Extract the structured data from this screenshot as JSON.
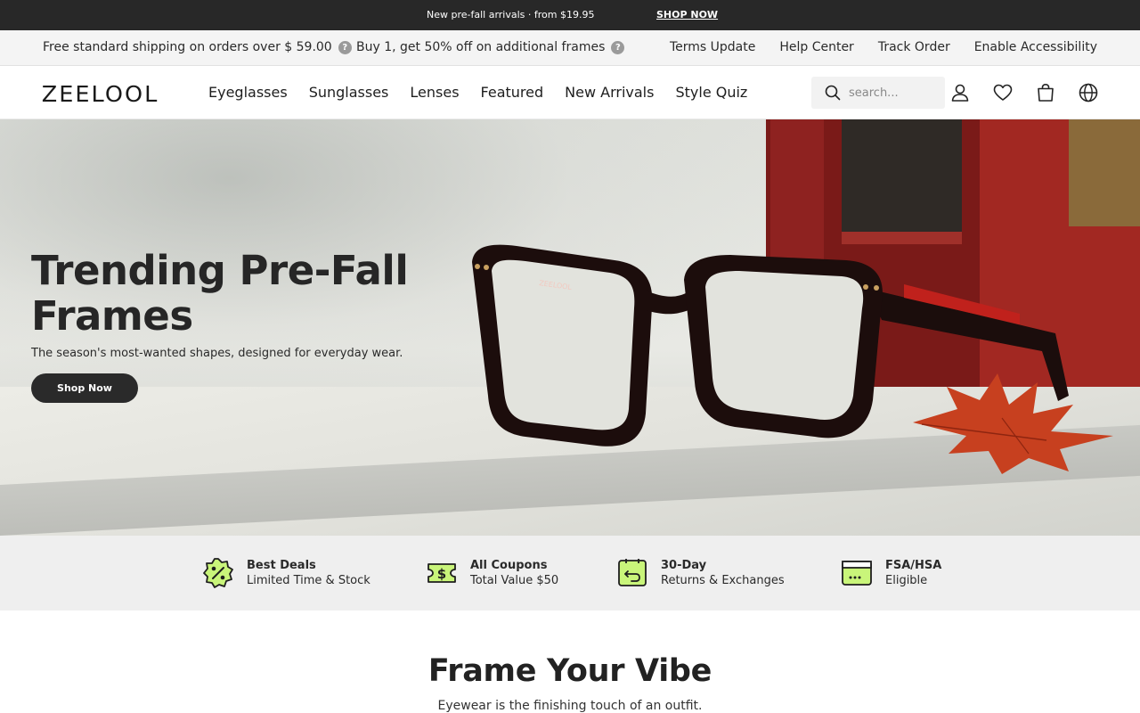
{
  "announcement": {
    "message": "New pre-fall arrivals · from $19.95",
    "cta": "SHOP NOW"
  },
  "utility": {
    "promos": [
      "Free standard shipping on orders over $ 59.00",
      "Buy 1, get 50% off on additional frames"
    ],
    "help_glyph": "?",
    "links": [
      "Terms Update",
      "Help Center",
      "Track Order",
      "Enable Accessibility"
    ]
  },
  "header": {
    "logo": "ZEELOOL",
    "nav": [
      "Eyeglasses",
      "Sunglasses",
      "Lenses",
      "Featured",
      "New Arrivals",
      "Style Quiz"
    ],
    "search_placeholder": "search...",
    "icons": [
      "search-icon",
      "account-icon",
      "wishlist-heart-icon",
      "shopping-bag-icon",
      "globe-icon"
    ]
  },
  "hero": {
    "title": "Trending Pre-Fall Frames",
    "subtitle": "The season's most-wanted shapes, designed for everyday wear.",
    "button": "Shop Now",
    "frame_brand": "ZEELOOL"
  },
  "benefits": [
    {
      "icon": "discount-badge-icon",
      "title": "Best Deals",
      "subtitle": "Limited Time & Stock"
    },
    {
      "icon": "coupon-ticket-icon",
      "title": "All Coupons",
      "subtitle": "Total Value $50"
    },
    {
      "icon": "return-arrow-icon",
      "title": "30-Day",
      "subtitle": "Returns & Exchanges"
    },
    {
      "icon": "card-icon",
      "title": "FSA/HSA",
      "subtitle": "Eligible"
    }
  ],
  "section": {
    "title": "Frame Your Vibe",
    "subtitle": "Eyewear is the finishing touch of an outfit."
  },
  "colors": {
    "announcement_bg": "#282828",
    "accent_green": "#c9f57a",
    "button_dark": "#2a2a2a",
    "frame_red": "#c0211c"
  }
}
